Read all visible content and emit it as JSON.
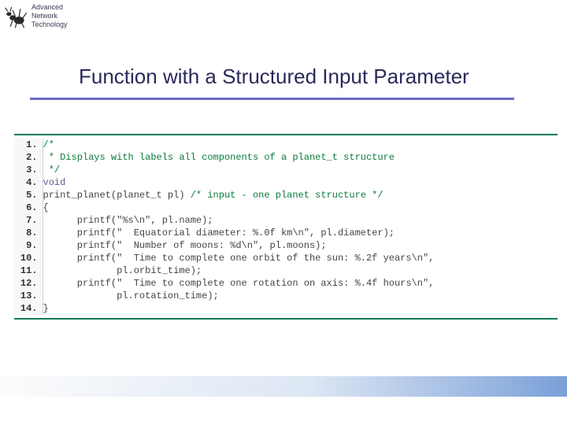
{
  "logo": {
    "line1": "Advanced",
    "line2": "Network",
    "line3": "Technology"
  },
  "slide": {
    "title": "Function with a Structured Input Parameter"
  },
  "code": {
    "linenos": "1.\n2.\n3.\n4.\n5.\n6.\n7.\n8.\n9.\n10.\n11.\n12.\n13.\n14.",
    "comment1": "/*",
    "comment2": " * Displays with labels all components of a planet_t structure",
    "comment3": " */",
    "kw_void": "void",
    "sig": "print_planet(planet_t pl) ",
    "sig_comment": "/* input - one planet structure */",
    "open_brace": "{",
    "l7": "      printf(\"%s\\n\", pl.name);",
    "l8": "      printf(\"  Equatorial diameter: %.0f km\\n\", pl.diameter);",
    "l9": "      printf(\"  Number of moons: %d\\n\", pl.moons);",
    "l10": "      printf(\"  Time to complete one orbit of the sun: %.2f years\\n\",",
    "l11": "             pl.orbit_time);",
    "l12": "      printf(\"  Time to complete one rotation on axis: %.4f hours\\n\",",
    "l13": "             pl.rotation_time);",
    "close_brace": "}"
  }
}
